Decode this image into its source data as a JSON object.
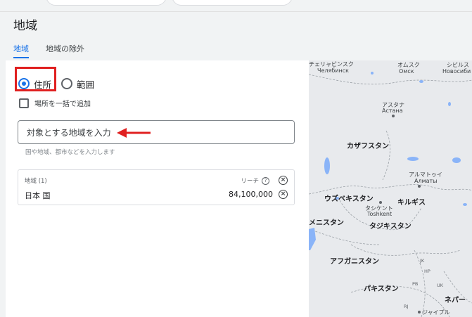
{
  "page": {
    "title": "地域"
  },
  "tabs": [
    {
      "label": "地域"
    },
    {
      "label": "地域の除外"
    }
  ],
  "location": {
    "mode_options": [
      "住所",
      "範囲"
    ],
    "selected_mode": "住所",
    "bulk_add_label": "場所を一括で追加",
    "search_placeholder": "対象とする地域を入力",
    "helper_text": "国や地域、都市などを入力します"
  },
  "targeted": {
    "header": "地域 (1)",
    "reach_label": "リーチ",
    "rows": [
      {
        "name": "日本 国",
        "reach": "84,100,000"
      }
    ]
  },
  "map": {
    "labels": [
      "チェリャビンスク",
      "Челябинск",
      "オムスク",
      "Омск",
      "シビルス",
      "Новосиби",
      "アスタナ",
      "Астана",
      "カザフスタン",
      "アルマトゥイ",
      "Алматы",
      "ウズベキスタン",
      "キルギス",
      "タシケント",
      "Toshkent",
      "メニスタン",
      "タジキスタン",
      "アフガニスタン",
      "パキスタン",
      "ネパー",
      "ジャイプル",
      "JK",
      "HP",
      "PB",
      "UK",
      "RJ"
    ],
    "colors": {
      "land": "#e8eaed",
      "water": "#8ab4f8",
      "border": "#9aa0a6"
    }
  },
  "accent_colors": {
    "primary": "#1a73e8",
    "highlight": "#e02020"
  }
}
